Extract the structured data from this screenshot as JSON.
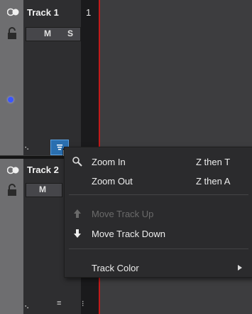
{
  "tracks": [
    {
      "name": "Track 1",
      "number": "1",
      "mute": "M",
      "solo": "S"
    },
    {
      "name": "Track 2",
      "mute": "M"
    }
  ],
  "context_menu": {
    "items": [
      {
        "label": "Zoom In",
        "shortcut": "Z then T",
        "icon": "magnifier-icon",
        "enabled": true
      },
      {
        "label": "Zoom Out",
        "shortcut": "Z then A",
        "enabled": true
      },
      {
        "label": "Move Track Up",
        "icon": "arrow-up-icon",
        "enabled": false
      },
      {
        "label": "Move Track Down",
        "icon": "arrow-down-icon",
        "enabled": true
      },
      {
        "label": "Track Color",
        "icon": "submenu-arrow-icon",
        "enabled": true
      }
    ]
  },
  "colors": {
    "accent": "#2a6fb0",
    "playhead": "#c21a1a",
    "record_indicator": "#3a55ff"
  }
}
